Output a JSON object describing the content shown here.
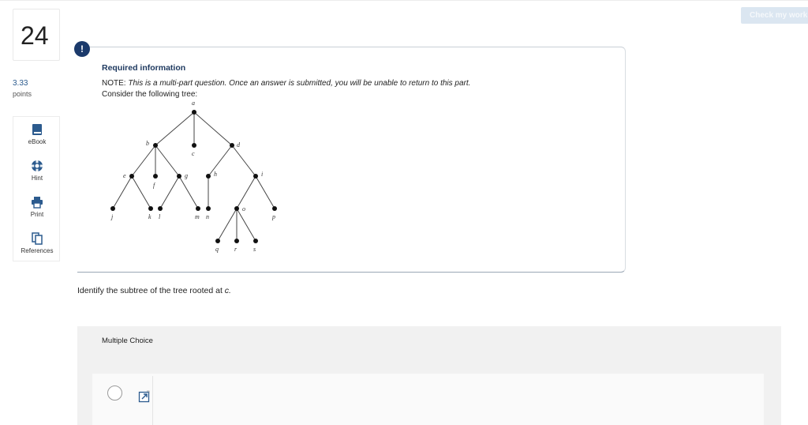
{
  "header": {
    "check_label": "Check my work"
  },
  "question": {
    "number": "24",
    "points_value": "3.33",
    "points_label": "points"
  },
  "tools": [
    {
      "label": "eBook",
      "icon": "book-icon"
    },
    {
      "label": "Hint",
      "icon": "lifebuoy-icon"
    },
    {
      "label": "Print",
      "icon": "printer-icon"
    },
    {
      "label": "References",
      "icon": "documents-icon"
    }
  ],
  "info": {
    "alert_icon": "!",
    "title": "Required information",
    "note_prefix": "NOTE:",
    "note_text": "This is a multi-part question. Once an answer is submitted, you will be unable to return to this part.",
    "consider": "Consider the following tree:"
  },
  "tree": {
    "labels": [
      "a",
      "b",
      "c",
      "d",
      "e",
      "f",
      "g",
      "h",
      "i",
      "j",
      "k",
      "l",
      "m",
      "n",
      "o",
      "p",
      "q",
      "r",
      "s"
    ]
  },
  "prompt": {
    "text": "Identify the subtree of the tree rooted at",
    "var": "c."
  },
  "multiple_choice": {
    "label": "Multiple Choice"
  },
  "colors": {
    "accent": "#1b3a6b",
    "link": "#2c5b8e",
    "button_disabled": "#dbe6f1",
    "panel": "#f1f1f1"
  }
}
